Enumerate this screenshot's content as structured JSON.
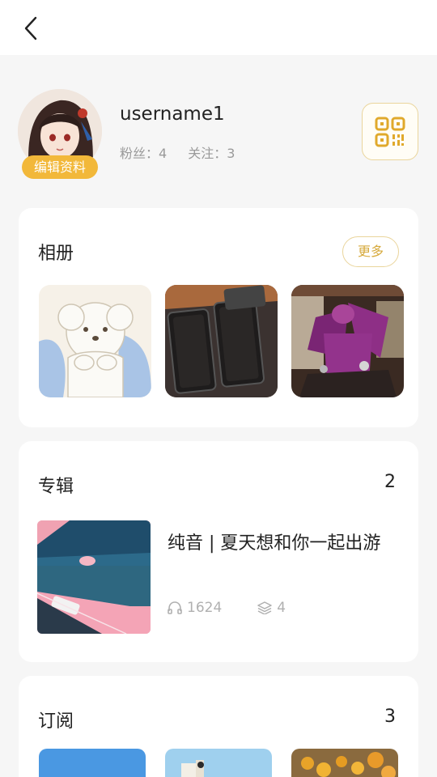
{
  "header": {
    "back_icon": "chevron-left-icon"
  },
  "profile": {
    "username": "username1",
    "edit_label": "编辑资料",
    "fans_label": "粉丝：4",
    "following_label": "关注：3",
    "qr_icon": "qr-code-icon",
    "accent_color": "#f2b83a"
  },
  "album": {
    "title": "相册",
    "more_label": "更多",
    "photos": [
      "puppy-illustration",
      "open-instrument-cases",
      "purple-figure-statue"
    ]
  },
  "collections": {
    "title": "专辑",
    "count": "2",
    "items": [
      {
        "title": "纯音 | 夏天想和你一起出游",
        "plays": "1624",
        "tracks": "4"
      }
    ]
  },
  "subscriptions": {
    "title": "订阅",
    "count": "3"
  }
}
